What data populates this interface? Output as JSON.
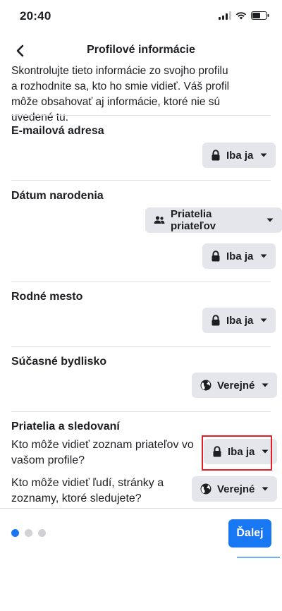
{
  "status_bar": {
    "time": "20:40"
  },
  "header": {
    "title": "Profilové informácie"
  },
  "intro_text": "Skontrolujte tieto informácie zo svojho profilu a rozhodnite sa, kto ho smie vidieť. Váš profil môže obsahovať aj informácie, ktoré nie sú uvedené tu.",
  "sections": {
    "email": {
      "title": "E-mailová adresa",
      "audience": "Iba ja"
    },
    "birthday": {
      "title": "Dátum narodenia",
      "audience_day_month": "Priatelia priateľov",
      "audience_year": "Iba ja"
    },
    "hometown": {
      "title": "Rodné mesto",
      "audience": "Iba ja"
    },
    "current_city": {
      "title": "Súčasné bydlisko",
      "audience": "Verejné"
    },
    "friends": {
      "title": "Priatelia a sledovaní",
      "friends_list_question": "Kto môže vidieť zoznam priateľov vo vašom profile?",
      "friends_list_audience": "Iba ja",
      "following_question": "Kto môže vidieť ľudí, stránky a zoznamy, ktoré sledujete?",
      "following_audience": "Verejné"
    }
  },
  "pagination": {
    "total": 3,
    "active": 1
  },
  "footer": {
    "next_label": "Ďalej"
  },
  "colors": {
    "accent": "#1877f2",
    "chip_bg": "#e4e6eb",
    "highlight": "#e41e26"
  },
  "icons": {
    "private": "lock-icon",
    "friends_of_friends": "people-icon",
    "public": "globe-icon"
  }
}
